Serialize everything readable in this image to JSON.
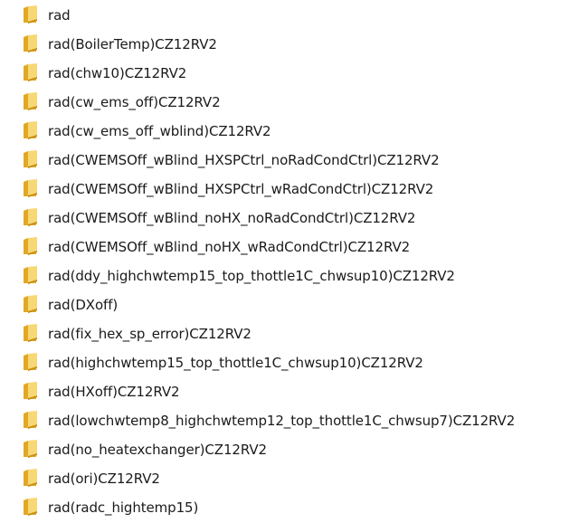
{
  "folder_icon": {
    "name": "folder-icon",
    "colors": {
      "back": "#E0A826",
      "front": "#F8D775",
      "shadow": "#C98F12"
    }
  },
  "folders": [
    {
      "name": "rad"
    },
    {
      "name": "rad(BoilerTemp)CZ12RV2"
    },
    {
      "name": "rad(chw10)CZ12RV2"
    },
    {
      "name": "rad(cw_ems_off)CZ12RV2"
    },
    {
      "name": "rad(cw_ems_off_wblind)CZ12RV2"
    },
    {
      "name": "rad(CWEMSOff_wBlind_HXSPCtrl_noRadCondCtrl)CZ12RV2"
    },
    {
      "name": "rad(CWEMSOff_wBlind_HXSPCtrl_wRadCondCtrl)CZ12RV2"
    },
    {
      "name": "rad(CWEMSOff_wBlind_noHX_noRadCondCtrl)CZ12RV2"
    },
    {
      "name": "rad(CWEMSOff_wBlind_noHX_wRadCondCtrl)CZ12RV2"
    },
    {
      "name": "rad(ddy_highchwtemp15_top_thottle1C_chwsup10)CZ12RV2"
    },
    {
      "name": "rad(DXoff)"
    },
    {
      "name": "rad(fix_hex_sp_error)CZ12RV2"
    },
    {
      "name": "rad(highchwtemp15_top_thottle1C_chwsup10)CZ12RV2"
    },
    {
      "name": "rad(HXoff)CZ12RV2"
    },
    {
      "name": "rad(lowchwtemp8_highchwtemp12_top_thottle1C_chwsup7)CZ12RV2"
    },
    {
      "name": "rad(no_heatexchanger)CZ12RV2"
    },
    {
      "name": "rad(ori)CZ12RV2"
    },
    {
      "name": "rad(radc_hightemp15)"
    }
  ]
}
